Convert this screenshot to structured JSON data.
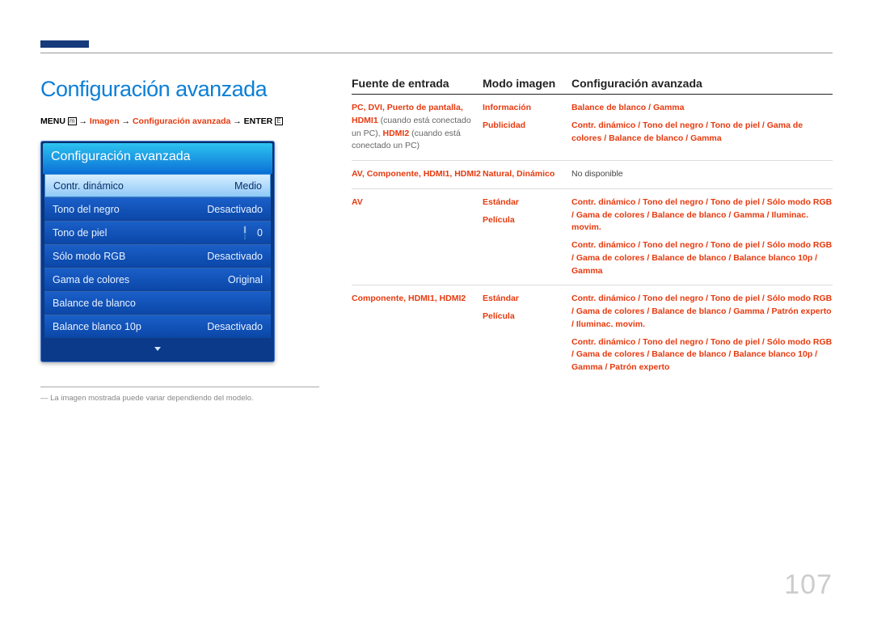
{
  "page_number": "107",
  "title": "Configuración avanzada",
  "breadcrumb": {
    "menu": "MENU",
    "menu_icon": "m",
    "path1": "Imagen",
    "path2": "Configuración avanzada",
    "enter": "ENTER",
    "enter_icon": "E"
  },
  "osd": {
    "header": "Configuración avanzada",
    "rows": [
      {
        "label": "Contr. dinámico",
        "value": "Medio",
        "selected": true
      },
      {
        "label": "Tono del negro",
        "value": "Desactivado"
      },
      {
        "label": "Tono de piel",
        "value": "0",
        "slider": true
      },
      {
        "label": "Sólo modo RGB",
        "value": "Desactivado"
      },
      {
        "label": "Gama de colores",
        "value": "Original"
      },
      {
        "label": "Balance de blanco",
        "value": ""
      },
      {
        "label": "Balance blanco 10p",
        "value": "Desactivado"
      }
    ]
  },
  "note": "― La imagen mostrada puede variar dependiendo del modelo.",
  "table": {
    "headers": {
      "src": "Fuente de entrada",
      "mode": "Modo imagen",
      "adv": "Configuración avanzada"
    },
    "rows": [
      {
        "src_segments": [
          {
            "t": "PC",
            "c": "red"
          },
          {
            "t": ", ",
            "c": "red"
          },
          {
            "t": "DVI",
            "c": "red"
          },
          {
            "t": ", ",
            "c": "red"
          },
          {
            "t": "Puerto de pantalla",
            "c": "red"
          },
          {
            "t": ", ",
            "c": "red"
          },
          {
            "t": "HDMI1",
            "c": "red"
          },
          {
            "t": " (cuando está conectado un PC), ",
            "c": "gray"
          },
          {
            "t": "HDMI2",
            "c": "red"
          },
          {
            "t": " (cuando está conectado un PC)",
            "c": "gray"
          }
        ],
        "subrows": [
          {
            "mode": [
              {
                "t": "Información",
                "c": "red"
              }
            ],
            "adv": [
              {
                "t": "Balance de blanco",
                "c": "red"
              },
              {
                "t": " / ",
                "c": "sep"
              },
              {
                "t": "Gamma",
                "c": "red"
              }
            ]
          },
          {
            "mode": [
              {
                "t": "Publicidad",
                "c": "red"
              }
            ],
            "adv": [
              {
                "t": "Contr. dinámico",
                "c": "red"
              },
              {
                "t": " / ",
                "c": "sep"
              },
              {
                "t": "Tono del negro",
                "c": "red"
              },
              {
                "t": " / ",
                "c": "sep"
              },
              {
                "t": "Tono de piel",
                "c": "red"
              },
              {
                "t": " / ",
                "c": "sep"
              },
              {
                "t": "Gama de colores",
                "c": "red"
              },
              {
                "t": " / ",
                "c": "sep"
              },
              {
                "t": "Balance de blanco",
                "c": "red"
              },
              {
                "t": " / ",
                "c": "sep"
              },
              {
                "t": "Gamma",
                "c": "red"
              }
            ]
          }
        ]
      },
      {
        "src_segments": [
          {
            "t": "AV",
            "c": "red"
          },
          {
            "t": ", ",
            "c": "red"
          },
          {
            "t": "Componente",
            "c": "red"
          },
          {
            "t": ", ",
            "c": "red"
          },
          {
            "t": "HDMI1",
            "c": "red"
          },
          {
            "t": ", ",
            "c": "red"
          },
          {
            "t": "HDMI2",
            "c": "red"
          }
        ],
        "subrows": [
          {
            "mode": [
              {
                "t": "Natural",
                "c": "red"
              },
              {
                "t": ", ",
                "c": "red"
              },
              {
                "t": "Dinámico",
                "c": "red"
              }
            ],
            "adv": [
              {
                "t": "No disponible",
                "c": "plain"
              }
            ]
          }
        ]
      },
      {
        "src_segments": [
          {
            "t": "AV",
            "c": "red"
          }
        ],
        "subrows": [
          {
            "mode": [
              {
                "t": "Estándar",
                "c": "red"
              }
            ],
            "adv": [
              {
                "t": "Contr. dinámico",
                "c": "red"
              },
              {
                "t": " / ",
                "c": "sep"
              },
              {
                "t": "Tono del negro",
                "c": "red"
              },
              {
                "t": " / ",
                "c": "sep"
              },
              {
                "t": "Tono de piel",
                "c": "red"
              },
              {
                "t": " / ",
                "c": "sep"
              },
              {
                "t": "Sólo modo RGB",
                "c": "red"
              },
              {
                "t": " / ",
                "c": "sep"
              },
              {
                "t": "Gama de colores",
                "c": "red"
              },
              {
                "t": " / ",
                "c": "sep"
              },
              {
                "t": "Balance de blanco",
                "c": "red"
              },
              {
                "t": " / ",
                "c": "sep"
              },
              {
                "t": "Gamma",
                "c": "red"
              },
              {
                "t": " / ",
                "c": "sep"
              },
              {
                "t": "Iluminac. movim.",
                "c": "red"
              }
            ]
          },
          {
            "mode": [
              {
                "t": "Película",
                "c": "red"
              }
            ],
            "adv": [
              {
                "t": "Contr. dinámico",
                "c": "red"
              },
              {
                "t": " / ",
                "c": "sep"
              },
              {
                "t": "Tono del negro",
                "c": "red"
              },
              {
                "t": " / ",
                "c": "sep"
              },
              {
                "t": "Tono de piel",
                "c": "red"
              },
              {
                "t": " / ",
                "c": "sep"
              },
              {
                "t": "Sólo modo RGB",
                "c": "red"
              },
              {
                "t": " / ",
                "c": "sep"
              },
              {
                "t": "Gama de colores",
                "c": "red"
              },
              {
                "t": " / ",
                "c": "sep"
              },
              {
                "t": "Balance de blanco",
                "c": "red"
              },
              {
                "t": " / ",
                "c": "sep"
              },
              {
                "t": "Balance blanco 10p",
                "c": "red"
              },
              {
                "t": " / ",
                "c": "sep"
              },
              {
                "t": "Gamma",
                "c": "red"
              }
            ]
          }
        ]
      },
      {
        "src_segments": [
          {
            "t": "Componente",
            "c": "red"
          },
          {
            "t": ", ",
            "c": "red"
          },
          {
            "t": "HDMI1",
            "c": "red"
          },
          {
            "t": ", ",
            "c": "red"
          },
          {
            "t": "HDMI2",
            "c": "red"
          }
        ],
        "subrows": [
          {
            "mode": [
              {
                "t": "Estándar",
                "c": "red"
              }
            ],
            "adv": [
              {
                "t": "Contr. dinámico",
                "c": "red"
              },
              {
                "t": " / ",
                "c": "sep"
              },
              {
                "t": "Tono del negro",
                "c": "red"
              },
              {
                "t": " / ",
                "c": "sep"
              },
              {
                "t": "Tono de piel",
                "c": "red"
              },
              {
                "t": " / ",
                "c": "sep"
              },
              {
                "t": "Sólo modo RGB",
                "c": "red"
              },
              {
                "t": " / ",
                "c": "sep"
              },
              {
                "t": "Gama de colores",
                "c": "red"
              },
              {
                "t": " / ",
                "c": "sep"
              },
              {
                "t": "Balance de blanco",
                "c": "red"
              },
              {
                "t": " / ",
                "c": "sep"
              },
              {
                "t": "Gamma",
                "c": "red"
              },
              {
                "t": " / ",
                "c": "sep"
              },
              {
                "t": "Patrón experto",
                "c": "red"
              },
              {
                "t": " / ",
                "c": "sep"
              },
              {
                "t": "Iluminac. movim.",
                "c": "red"
              }
            ]
          },
          {
            "mode": [
              {
                "t": "Película",
                "c": "red"
              }
            ],
            "adv": [
              {
                "t": "Contr. dinámico",
                "c": "red"
              },
              {
                "t": " / ",
                "c": "sep"
              },
              {
                "t": "Tono del negro",
                "c": "red"
              },
              {
                "t": " / ",
                "c": "sep"
              },
              {
                "t": "Tono de piel",
                "c": "red"
              },
              {
                "t": " / ",
                "c": "sep"
              },
              {
                "t": "Sólo modo RGB",
                "c": "red"
              },
              {
                "t": " / ",
                "c": "sep"
              },
              {
                "t": "Gama de colores",
                "c": "red"
              },
              {
                "t": " / ",
                "c": "sep"
              },
              {
                "t": "Balance de blanco",
                "c": "red"
              },
              {
                "t": " / ",
                "c": "sep"
              },
              {
                "t": "Balance blanco 10p",
                "c": "red"
              },
              {
                "t": " / ",
                "c": "sep"
              },
              {
                "t": "Gamma",
                "c": "red"
              },
              {
                "t": " / ",
                "c": "sep"
              },
              {
                "t": "Patrón experto",
                "c": "red"
              }
            ]
          }
        ]
      }
    ]
  }
}
